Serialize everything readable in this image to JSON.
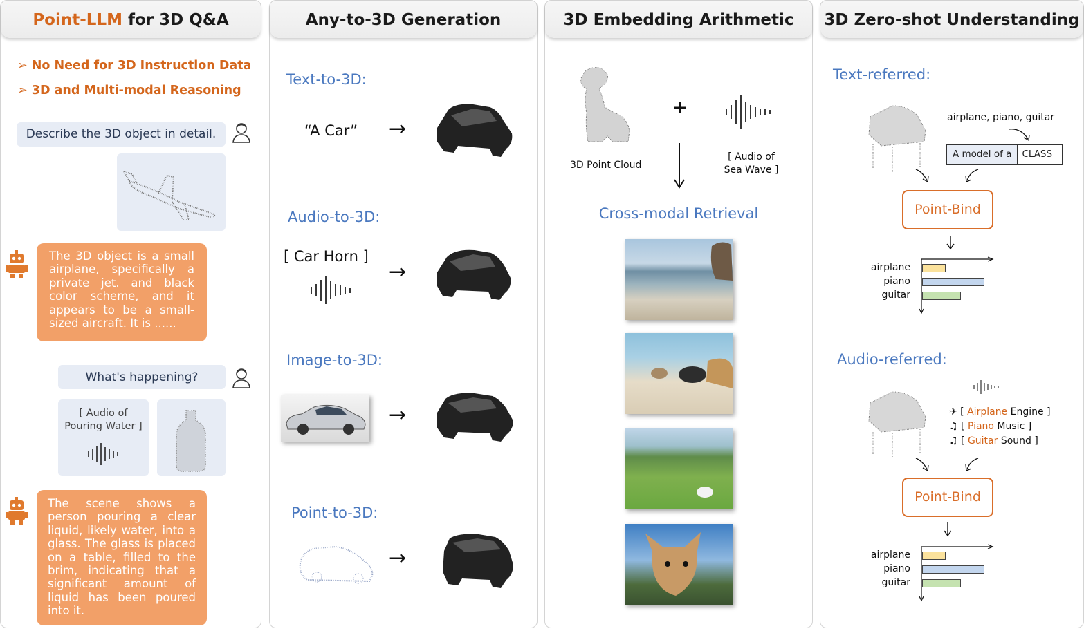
{
  "panel1": {
    "title_highlight": "Point-LLM",
    "title_rest": " for 3D Q&A",
    "bullets": [
      "No Need for 3D Instruction Data",
      "3D and Multi-modal Reasoning"
    ],
    "user_q1": "Describe the 3D object in detail.",
    "answer1": "The 3D object is a small airplane, specifically a private jet. and black color scheme, and it appears to be a small-sized aircraft. It is ......",
    "user_q2": "What's happening?",
    "audio_label": "[ Audio of Pouring Water ]",
    "answer2": "The scene shows a person pouring a clear liquid, likely water, into a glass. The glass is placed on a table, filled to the brim, indicating that a significant amount of liquid has been poured into it."
  },
  "panel2": {
    "title": "Any-to-3D Generation",
    "sections": [
      {
        "label": "Text-to-3D:",
        "input": "“A Car”"
      },
      {
        "label": "Audio-to-3D:",
        "input": "[ Car Horn ]"
      },
      {
        "label": "Image-to-3D:",
        "input": ""
      },
      {
        "label": "Point-to-3D:",
        "input": ""
      }
    ],
    "arrow": "→"
  },
  "panel3": {
    "title": "3D Embedding Arithmetic",
    "point_cloud_label": "3D Point Cloud",
    "plus": "+",
    "audio_label": "[ Audio of Sea Wave ]",
    "retrieval_label": "Cross-modal Retrieval"
  },
  "panel4": {
    "title": "3D Zero-shot Understanding",
    "text_referred": "Text-referred:",
    "class_words": "airplane, piano, guitar",
    "template_a": "A model of a",
    "template_b": "CLASS",
    "point_bind": "Point-Bind",
    "audio_referred": "Audio-referred:",
    "audio_items": [
      {
        "colored": "Airplane",
        "rest": " Engine"
      },
      {
        "colored": "Piano",
        "rest": " Music"
      },
      {
        "colored": "Guitar",
        "rest": " Sound"
      }
    ],
    "bar_labels": [
      "airplane",
      "piano",
      "guitar"
    ],
    "bars_text": [
      0.28,
      0.75,
      0.47
    ],
    "bars_audio": [
      0.28,
      0.75,
      0.47
    ],
    "bar_colors": [
      "#fbe29c",
      "#c3d6ee",
      "#c5e2b0"
    ]
  }
}
